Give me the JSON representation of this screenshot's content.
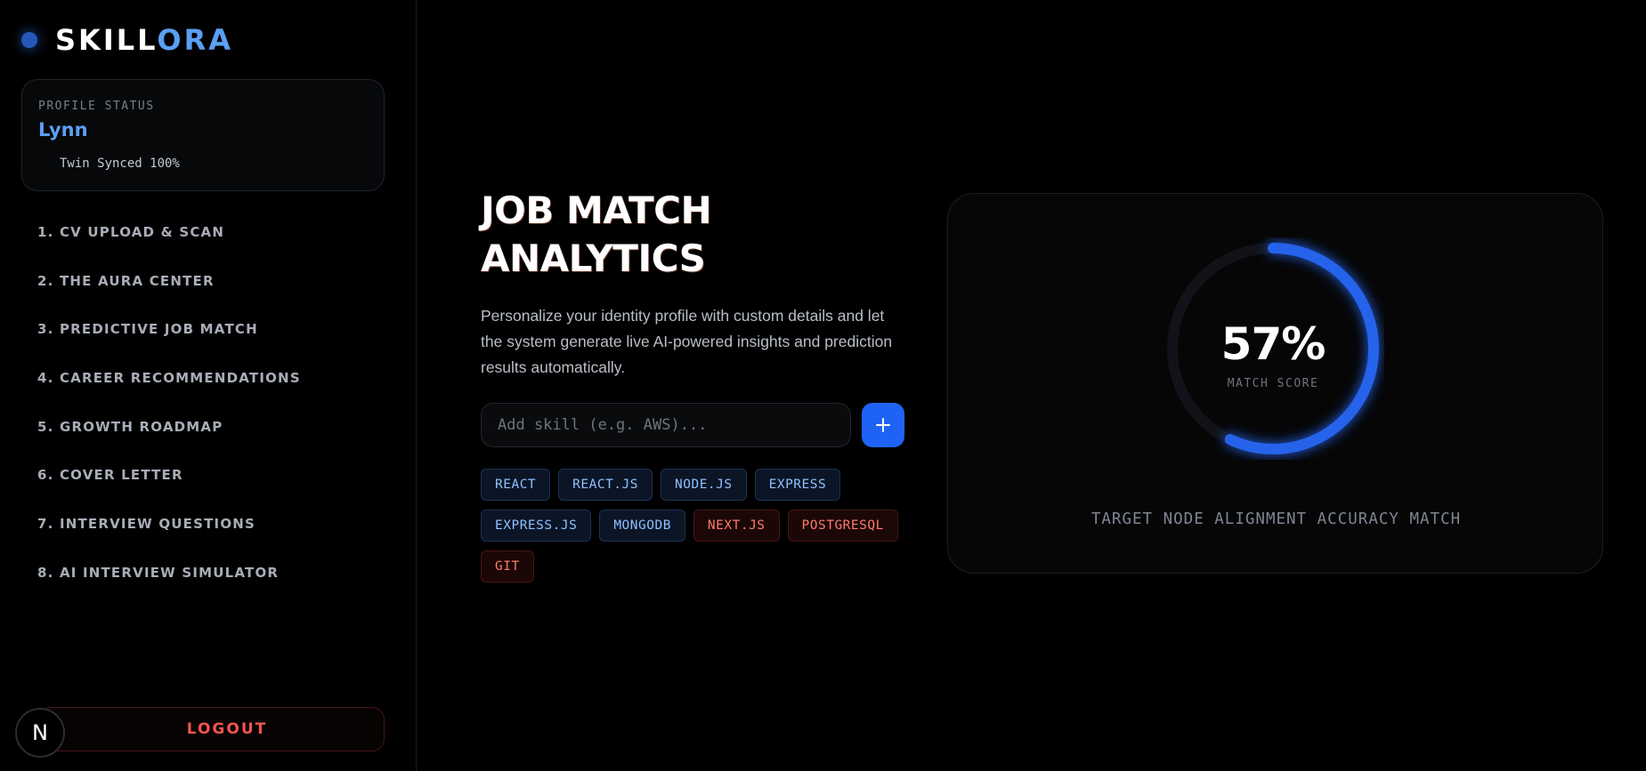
{
  "brand": {
    "part1": "SKILL",
    "part2": "ORA"
  },
  "profile": {
    "status_label": "PROFILE STATUS",
    "name": "Lynn",
    "sync": "Twin Synced 100%"
  },
  "nav": {
    "items": [
      {
        "label": "1. CV UPLOAD & SCAN"
      },
      {
        "label": "2. THE AURA CENTER"
      },
      {
        "label": "3. PREDICTIVE JOB MATCH"
      },
      {
        "label": "4. CAREER RECOMMENDATIONS"
      },
      {
        "label": "5. GROWTH ROADMAP"
      },
      {
        "label": "6. COVER LETTER"
      },
      {
        "label": "7. INTERVIEW QUESTIONS"
      },
      {
        "label": "8. AI INTERVIEW SIMULATOR"
      }
    ]
  },
  "logout_label": "LOGOUT",
  "badge_letter": "N",
  "main": {
    "title_line1": "JOB MATCH",
    "title_line2": "ANALYTICS",
    "description": "Personalize your identity profile with custom details and let the system generate live AI-powered insights and prediction results automatically.",
    "skill_input": {
      "placeholder": "Add skill (e.g. AWS)...",
      "value": ""
    },
    "add_icon": "plus-icon",
    "skills": [
      {
        "label": "REACT",
        "status": "matched"
      },
      {
        "label": "REACT.JS",
        "status": "matched"
      },
      {
        "label": "NODE.JS",
        "status": "matched"
      },
      {
        "label": "EXPRESS",
        "status": "matched"
      },
      {
        "label": "EXPRESS.JS",
        "status": "matched"
      },
      {
        "label": "MONGODB",
        "status": "matched"
      },
      {
        "label": "NEXT.JS",
        "status": "missing"
      },
      {
        "label": "POSTGRESQL",
        "status": "missing"
      },
      {
        "label": "GIT",
        "status": "missing"
      }
    ]
  },
  "score": {
    "value_text": "57%",
    "value": 57,
    "label": "MATCH SCORE",
    "footer": "TARGET NODE ALIGNMENT ACCURACY MATCH"
  },
  "colors": {
    "accent": "#1f63f5",
    "brand_light": "#5b9ff3",
    "matched_text": "#8ec0ff",
    "missing_text": "#ff7a6b",
    "logout": "#f0554d",
    "gauge_track": "#111318",
    "gauge_fill": "#2563eb"
  }
}
